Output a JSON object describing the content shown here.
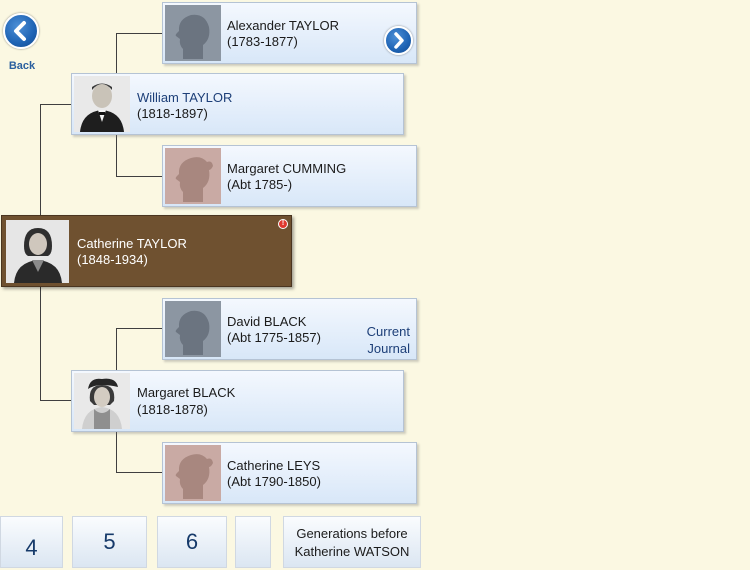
{
  "nav": {
    "back_label": "Back"
  },
  "people": {
    "alexander": {
      "name": "Alexander TAYLOR",
      "dates": "(1783-1877)"
    },
    "william": {
      "name": "William TAYLOR",
      "dates": "(1818-1897)"
    },
    "margaret_cumming": {
      "name": "Margaret CUMMING",
      "dates": "(Abt 1785-)"
    },
    "catherine_taylor": {
      "name": "Catherine TAYLOR",
      "dates": "(1848-1934)"
    },
    "david": {
      "name": "David BLACK",
      "dates": "(Abt 1775-1857)"
    },
    "margaret_black": {
      "name": "Margaret BLACK",
      "dates": "(1818-1878)"
    },
    "catherine_leys": {
      "name": "Catherine LEYS",
      "dates": "(Abt 1790-1850)"
    }
  },
  "journal": {
    "line1": "Current",
    "line2": "Journal"
  },
  "generations": {
    "buttons": [
      "4",
      "5",
      "6",
      ""
    ],
    "label_line1": "Generations before",
    "label_line2": "Katherine WATSON"
  },
  "colors": {
    "background": "#fbf8e2",
    "focus_card": "#6f5130",
    "accent_blue": "#1e63b4",
    "connector": "#3f3f3f"
  },
  "icons": {
    "back": "back-arrow-icon",
    "next": "chevron-right-icon",
    "alert": "alert-dot-icon"
  }
}
